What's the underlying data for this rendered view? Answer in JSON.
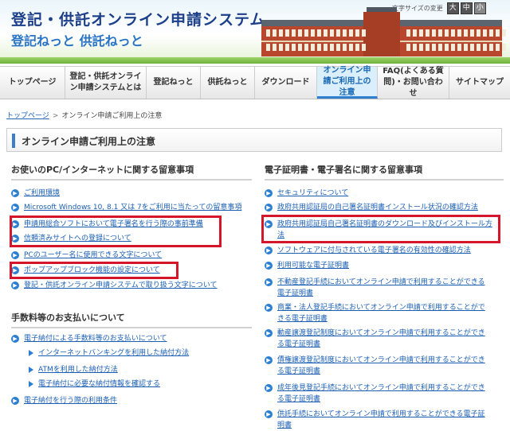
{
  "header": {
    "title": "登記・供託オンライン申請システム",
    "subtitle": "登記ねっと 供託ねっと",
    "font_size_label": "文字サイズの変更",
    "font_sizes": [
      "大",
      "中",
      "小"
    ]
  },
  "nav": [
    {
      "label": "トップページ"
    },
    {
      "label": "登記・供託オンライン申請システムとは"
    },
    {
      "label": "登記ねっと"
    },
    {
      "label": "供託ねっと"
    },
    {
      "label": "ダウンロード"
    },
    {
      "label": "オンライン申請ご利用上の注意",
      "active": true
    },
    {
      "label": "FAQ(よくある質問)・お問い合わせ"
    },
    {
      "label": "サイトマップ"
    }
  ],
  "breadcrumb": {
    "home": "トップページ",
    "current": "オンライン申請ご利用上の注意"
  },
  "page_title": "オンライン申請ご利用上の注意",
  "left": {
    "section1_title": "お使いのPC/インターネットに関する留意事項",
    "section1_links": [
      "ご利用環境",
      "Microsoft Windows 10, 8.1 又は 7をご利用に当たっての留意事項",
      "申請用総合ソフトにおいて電子署名を行う際の事前準備",
      "信頼済みサイトへの登録について",
      "PCのユーザー名に使用できる文字について",
      "ポップアップブロック機能の設定について",
      "登記・供託オンライン申請システムで取り扱う文字について"
    ],
    "section2_title": "手数料等のお支払いについて",
    "section2_links": [
      "電子納付による手数料等のお支払いについて",
      "インターネットバンキングを利用した納付方法",
      "ATMを利用した納付方法",
      "電子納付に必要な納付情報を確認する",
      "電子納付を行う際の利用条件"
    ]
  },
  "right": {
    "section_title": "電子証明書・電子署名に関する留意事項",
    "links": [
      "セキュリティについて",
      "政府共用認証局の自己署名証明書インストール状況の確認方法",
      "政府共用認証局自己署名証明書のダウンロード及びインストール方法",
      "ソフトウェアに付与されている電子署名の有効性の確認方法",
      "利用可能な電子証明書",
      "不動産登記手続においてオンライン申請で利用することができる電子証明書",
      "商業・法人登記手続においてオンライン申請で利用することができる電子証明書",
      "動産譲渡登記制度においてオンライン申請で利用することができる電子証明書",
      "債権譲渡登記制度においてオンライン申請で利用することができる電子証明書",
      "成年後見登記手続においてオンライン申請で利用することができる電子証明書",
      "供託手続においてオンライン申請で利用することができる電子証明書"
    ]
  },
  "colors": {
    "accent": "#2c7fd0",
    "highlight": "#d5152a",
    "link": "#1a5fb4"
  }
}
